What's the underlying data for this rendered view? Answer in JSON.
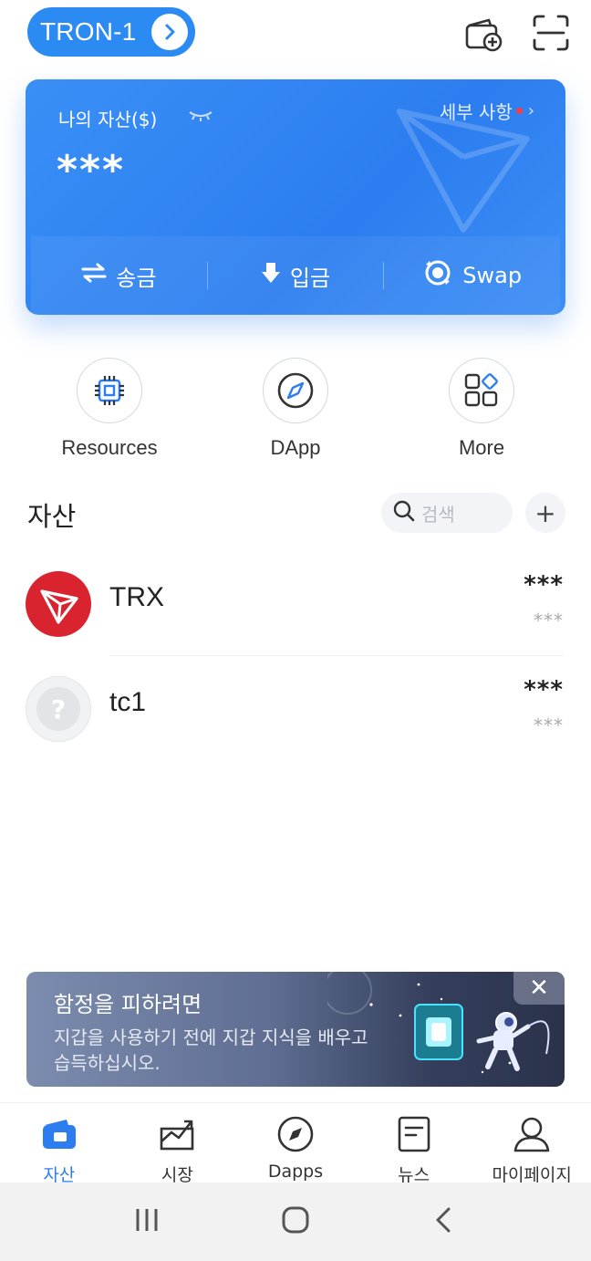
{
  "header": {
    "network_label": "TRON-1",
    "icons": [
      "wallet-add-icon",
      "scan-icon"
    ]
  },
  "balance_card": {
    "title": "나의 자산($)",
    "detail_label": "세부 사항",
    "balance": "***",
    "actions": [
      {
        "label": "송금",
        "icon": "transfer-icon"
      },
      {
        "label": "입금",
        "icon": "receive-icon"
      },
      {
        "label": "Swap",
        "icon": "swap-icon"
      }
    ]
  },
  "quick_actions": [
    {
      "label": "Resources",
      "icon": "chip-icon"
    },
    {
      "label": "DApp",
      "icon": "compass-icon"
    },
    {
      "label": "More",
      "icon": "grid-icon"
    }
  ],
  "assets": {
    "title": "자산",
    "search_placeholder": "검색",
    "add_label": "+",
    "tokens": [
      {
        "name": "TRX",
        "amount": "***",
        "value": "***",
        "icon": "trx-logo"
      },
      {
        "name": "tc1",
        "amount": "***",
        "value": "***",
        "icon": "unknown-token-logo"
      }
    ]
  },
  "banner": {
    "title": "함정을 피하려면",
    "description": "지갑을 사용하기 전에 지갑 지식을 배우고 습득하십시오.",
    "close_label": "✕"
  },
  "tabbar": {
    "items": [
      {
        "label": "자산",
        "icon": "wallet-icon",
        "active": true
      },
      {
        "label": "시장",
        "icon": "chart-icon",
        "active": false
      },
      {
        "label": "Dapps",
        "icon": "compass-icon",
        "active": false
      },
      {
        "label": "뉴스",
        "icon": "news-icon",
        "active": false
      },
      {
        "label": "마이페이지",
        "icon": "user-icon",
        "active": false
      }
    ]
  },
  "colors": {
    "primary": "#2c7ef0",
    "trx_red": "#d9232f"
  }
}
